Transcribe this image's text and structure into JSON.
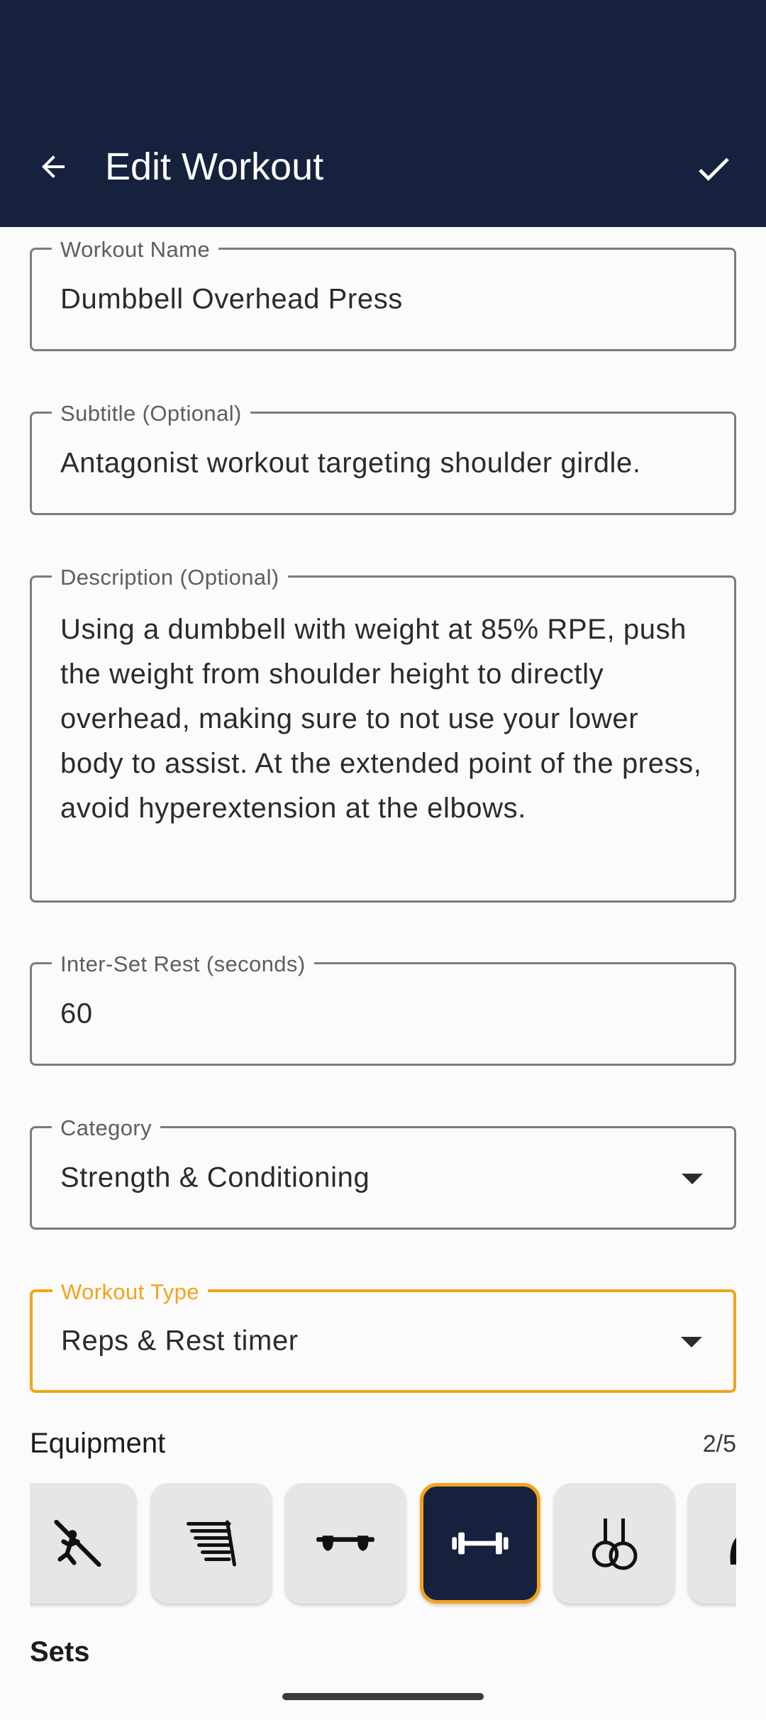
{
  "appbar": {
    "title": "Edit Workout",
    "back_icon": "arrow-back-icon",
    "confirm_icon": "check-icon"
  },
  "form": {
    "workout_name": {
      "label": "Workout Name",
      "value": "Dumbbell Overhead Press"
    },
    "subtitle": {
      "label": "Subtitle (Optional)",
      "value": "Antagonist workout targeting shoulder girdle."
    },
    "description": {
      "label": "Description (Optional)",
      "value": "Using a dumbbell with weight at 85% RPE, push the weight from shoulder height to directly overhead, making sure to not use your lower body to assist. At the extended point of the press, avoid hyperextension at the elbows."
    },
    "inter_set_rest": {
      "label": "Inter-Set Rest (seconds)",
      "value": "60"
    },
    "category": {
      "label": "Category",
      "value": "Strength & Conditioning"
    },
    "workout_type": {
      "label": "Workout Type",
      "value": "Reps & Rest timer"
    }
  },
  "equipment": {
    "title": "Equipment",
    "count": "2/5",
    "items": [
      {
        "icon": "climbing-wall-icon",
        "selected": false
      },
      {
        "icon": "hangboard-icon",
        "selected": false
      },
      {
        "icon": "pull-up-grips-icon",
        "selected": false
      },
      {
        "icon": "dumbbell-icon",
        "selected": true
      },
      {
        "icon": "gymnastic-rings-icon",
        "selected": false
      },
      {
        "icon": "kettlebell-icon",
        "selected": false
      }
    ]
  },
  "sets": {
    "title": "Sets"
  },
  "colors": {
    "appbar": "#16213d",
    "accent": "#f2a31b",
    "outline": "#7b7b80",
    "tile": "#e6e6e8"
  }
}
